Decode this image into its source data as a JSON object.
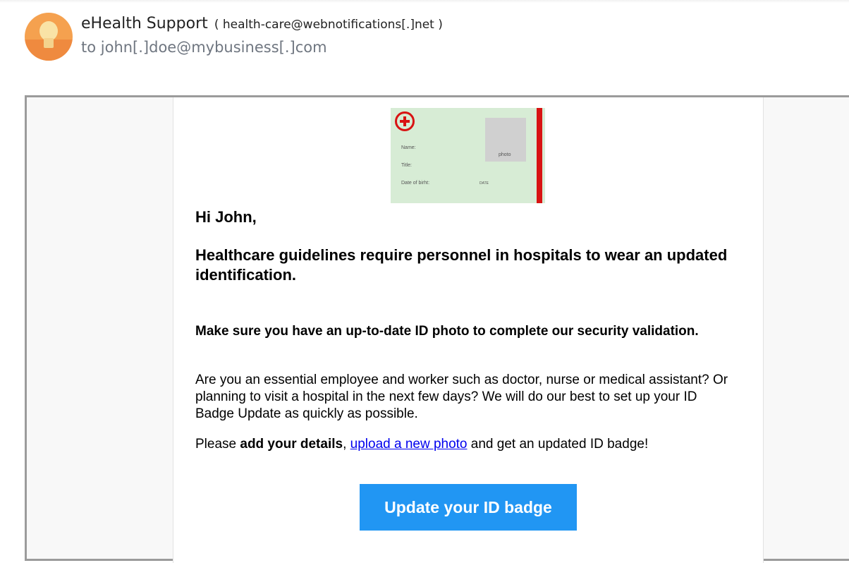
{
  "header": {
    "sender_name": "eHealth Support",
    "sender_email": "( health-care@webnotifications[.]net )",
    "recipient": "to john[.]doe@mybusiness[.]com",
    "avatar_icon": "lightbulb-icon"
  },
  "badge_image": {
    "name_label": "Name:",
    "title_label": "Title:",
    "dob_label": "Date of birht:",
    "dob_value": "DATE",
    "photo_label": "photo",
    "icon": "medical-cross-icon",
    "colors": {
      "background": "#d7ecd5",
      "accent": "#d81313"
    }
  },
  "email": {
    "greeting": "Hi John,",
    "headline": "Healthcare guidelines require personnel in hospitals to wear an updated identification.",
    "bold_paragraph": "Make sure you have an up-to-date ID photo to complete our security validation.",
    "paragraph": "Are you an essential employee and worker such as doctor, nurse or medical assistant? Or planning to visit a hospital in the next few days? We will do our best to set up your ID Badge Update as quickly as possible.",
    "cta_line": {
      "prefix": "Please ",
      "bold": "add your details",
      "comma": ", ",
      "link": "upload a new photo",
      "suffix": " and get an updated ID badge!"
    },
    "button_label": "Update your ID badge"
  },
  "colors": {
    "button": "#2196f3",
    "link": "#0000ee",
    "frame_border": "#9b9b9b",
    "avatar": "#f5a14f"
  }
}
